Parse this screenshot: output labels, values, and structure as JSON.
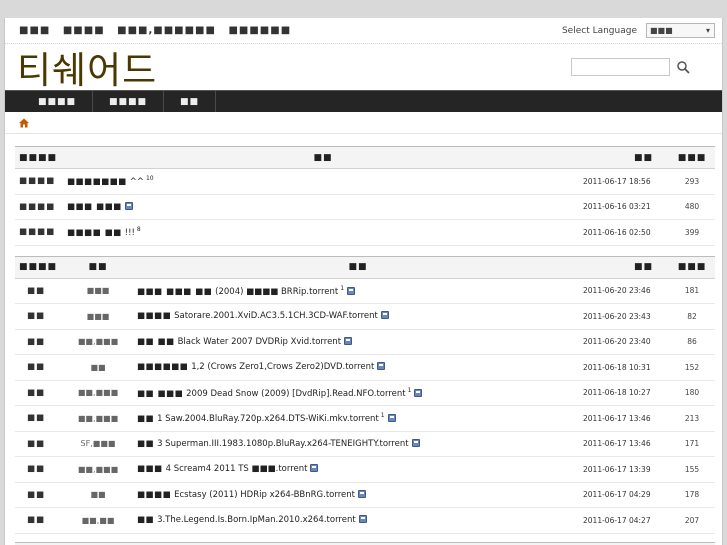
{
  "topbar": {
    "links": [
      "■■■",
      "■■■■",
      "■■■,■■■■■■",
      "■■■■■■"
    ],
    "language_label": "Select Language",
    "language_value": "■■■"
  },
  "header": {
    "logo": "티쉐어드",
    "search_placeholder": ""
  },
  "nav": {
    "items": [
      "■■■■",
      "■■■■",
      "■■"
    ]
  },
  "notice_table": {
    "headers": [
      "■■■■",
      "■■",
      "■■",
      "■■■"
    ],
    "rows": [
      {
        "category": "■■■■",
        "title": "■■■■■■■",
        "extra": "^^",
        "comments": "10",
        "date": "2011-06-17 18:56",
        "views": "293"
      },
      {
        "category": "■■■■",
        "title": "■■■ ■■■",
        "extra": "",
        "comments": "",
        "date": "2011-06-16 03:21",
        "views": "480"
      },
      {
        "category": "■■■■",
        "title": "■■■■ ■■",
        "extra": "!!!",
        "comments": "8",
        "date": "2011-06-16 02:50",
        "views": "399"
      }
    ]
  },
  "torrent_table": {
    "headers": [
      "■■■■",
      "■■",
      "■■",
      "■■",
      "■■■"
    ],
    "rows": [
      {
        "cat": "■■",
        "sub": "■■■",
        "title_kr": "■■■ ■■■ ■■",
        "title": "(2004) ■■■■ BRRip.torrent",
        "comments": "1",
        "date": "2011-06-20 23:46",
        "views": "181"
      },
      {
        "cat": "■■",
        "sub": "■■■",
        "title_kr": "■■■■",
        "title": "Satorare.2001.XviD.AC3.5.1CH.3CD-WAF.torrent",
        "comments": "",
        "date": "2011-06-20 23:43",
        "views": "82"
      },
      {
        "cat": "■■",
        "sub": "■■,■■■",
        "title_kr": "■■ ■■",
        "title": "Black Water 2007 DVDRip Xvid.torrent",
        "comments": "",
        "date": "2011-06-20 23:40",
        "views": "86"
      },
      {
        "cat": "■■",
        "sub": "■■",
        "title_kr": "■■■■■■",
        "title": "1,2 (Crows Zero1,Crows Zero2)DVD.torrent",
        "comments": "",
        "date": "2011-06-18 10:31",
        "views": "152"
      },
      {
        "cat": "■■",
        "sub": "■■,■■■",
        "title_kr": "■■ ■■■",
        "title": "2009 Dead Snow (2009) [DvdRip].Read.NFO.torrent",
        "comments": "1",
        "date": "2011-06-18 10:27",
        "views": "180"
      },
      {
        "cat": "■■",
        "sub": "■■,■■■",
        "title_kr": "■■",
        "title": "1 Saw.2004.BluRay.720p.x264.DTS-WiKi.mkv.torrent",
        "comments": "1",
        "date": "2011-06-17 13:46",
        "views": "213"
      },
      {
        "cat": "■■",
        "sub": "SF,■■■",
        "title_kr": "■■",
        "title": "3 Superman.III.1983.1080p.BluRay.x264-TENEIGHTY.torrent",
        "comments": "",
        "date": "2011-06-17 13:46",
        "views": "171"
      },
      {
        "cat": "■■",
        "sub": "■■,■■■",
        "title_kr": "■■■",
        "title": "4 Scream4 2011 TS ■■■.torrent",
        "comments": "",
        "date": "2011-06-17 13:39",
        "views": "155"
      },
      {
        "cat": "■■",
        "sub": "■■",
        "title_kr": "■■■■",
        "title": "Ecstasy (2011) HDRip x264-BBnRG.torrent",
        "comments": "",
        "date": "2011-06-17 04:29",
        "views": "178"
      },
      {
        "cat": "■■",
        "sub": "■■,■■",
        "title_kr": "■■",
        "title": "3.The.Legend.Is.Born.IpMan.2010.x264.torrent",
        "comments": "",
        "date": "2011-06-17 04:27",
        "views": "207"
      }
    ]
  },
  "bottom_table": {
    "headers": [
      "■■■■",
      "■■",
      "■■"
    ]
  },
  "colors": {
    "nav_bg": "#252525",
    "logo": "#4a3800",
    "file_icon": "#6b86b8"
  }
}
